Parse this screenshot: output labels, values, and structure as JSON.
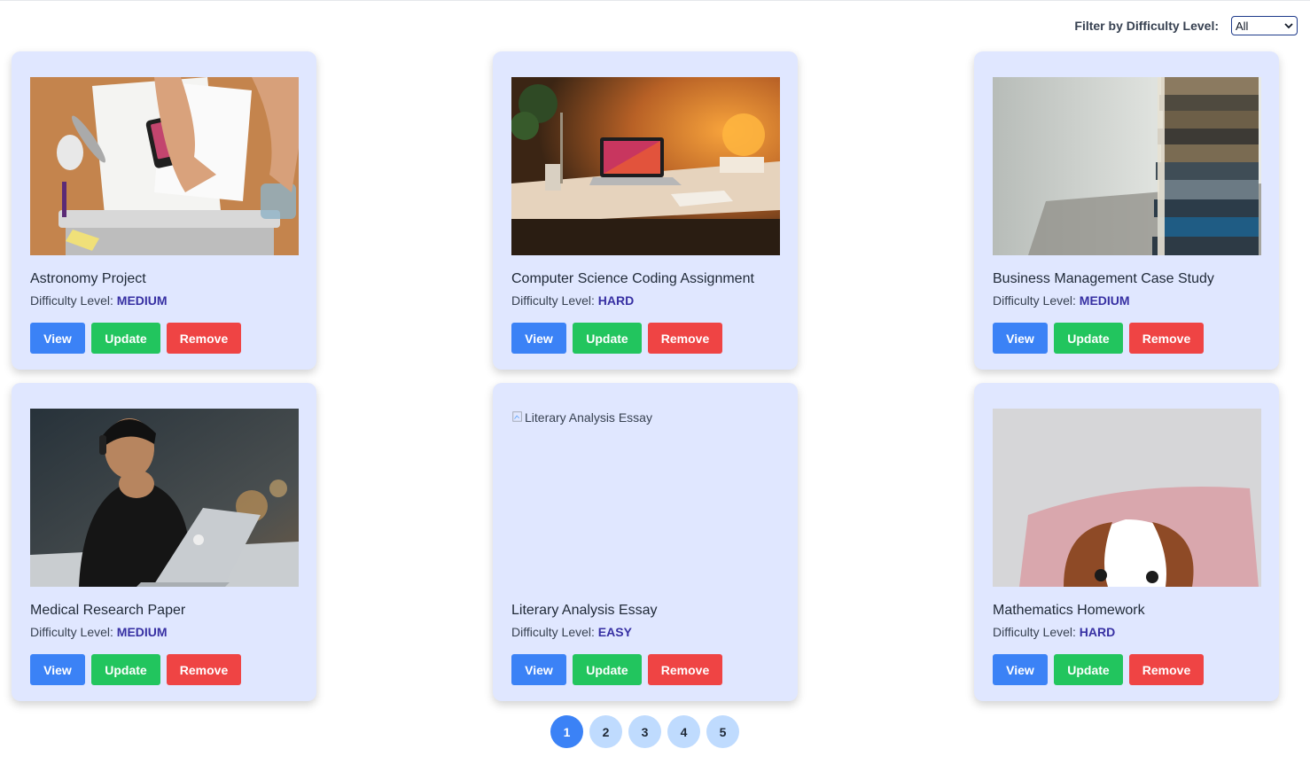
{
  "filter": {
    "label": "Filter by Difficulty Level:",
    "selected": "All"
  },
  "cards": [
    {
      "title": "Astronomy Project",
      "difficulty_label": "Difficulty Level:",
      "difficulty": "MEDIUM"
    },
    {
      "title": "Computer Science Coding Assignment",
      "difficulty_label": "Difficulty Level:",
      "difficulty": "HARD"
    },
    {
      "title": "Business Management Case Study",
      "difficulty_label": "Difficulty Level:",
      "difficulty": "MEDIUM"
    },
    {
      "title": "Medical Research Paper",
      "difficulty_label": "Difficulty Level:",
      "difficulty": "MEDIUM"
    },
    {
      "title": "Literary Analysis Essay",
      "difficulty_label": "Difficulty Level:",
      "difficulty": "EASY",
      "image_alt": "Literary Analysis Essay"
    },
    {
      "title": "Mathematics Homework",
      "difficulty_label": "Difficulty Level:",
      "difficulty": "HARD"
    }
  ],
  "actions": {
    "view": "View",
    "update": "Update",
    "remove": "Remove"
  },
  "pagination": {
    "pages": [
      "1",
      "2",
      "3",
      "4",
      "5"
    ],
    "current": "1"
  },
  "colors": {
    "card_bg": "#e0e7ff",
    "view": "#3b82f6",
    "update": "#22c55e",
    "remove": "#ef4444",
    "difficulty": "#3730a3",
    "page_active": "#3b82f6",
    "page": "#bfdbfe"
  }
}
